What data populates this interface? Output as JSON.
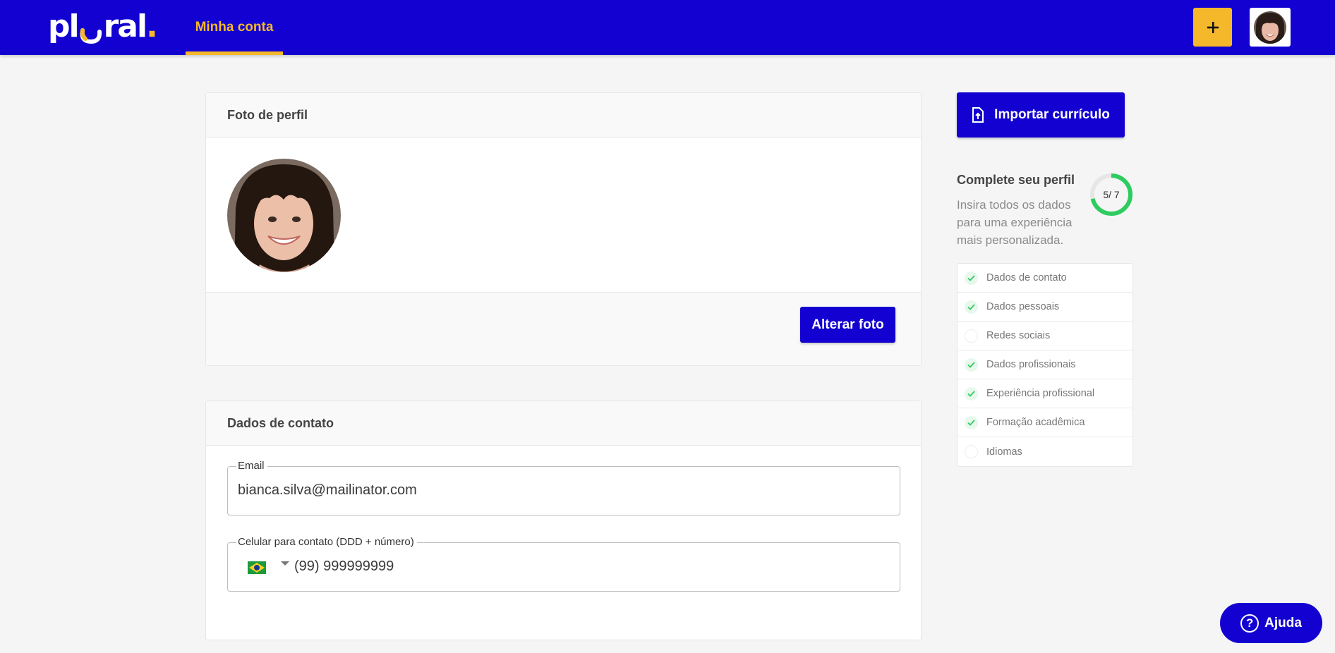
{
  "header": {
    "logo_text_left": "pl",
    "logo_text_right": "ral",
    "logo_dot": ".",
    "nav_tab": "Minha conta",
    "add_icon": "plus-icon"
  },
  "photo_card": {
    "title": "Foto de perfil",
    "button": "Alterar foto"
  },
  "contact_card": {
    "title": "Dados de contato",
    "email_label": "Email",
    "email_value": "bianca.silva@mailinator.com",
    "phone_label": "Celular para contato (DDD + número)",
    "phone_value": "(99) 999999999",
    "country_flag": "brazil-flag-icon"
  },
  "sidebar": {
    "import_button": "Importar currículo",
    "complete_title": "Complete seu perfil",
    "complete_desc": "Insira todos os dados para uma experiência mais personalizada.",
    "progress_label": "5/ 7",
    "progress_completed": 5,
    "progress_total": 7,
    "items": [
      {
        "label": "Dados de contato",
        "done": true
      },
      {
        "label": "Dados pessoais",
        "done": true
      },
      {
        "label": "Redes sociais",
        "done": false
      },
      {
        "label": "Dados profissionais",
        "done": true
      },
      {
        "label": "Experiência profissional",
        "done": true
      },
      {
        "label": "Formação acadêmica",
        "done": true
      },
      {
        "label": "Idiomas",
        "done": false
      }
    ]
  },
  "help": {
    "label": "Ajuda",
    "icon": "?"
  },
  "colors": {
    "primary": "#1201d0",
    "accent": "#f6b82b",
    "success": "#2ecc5f"
  }
}
